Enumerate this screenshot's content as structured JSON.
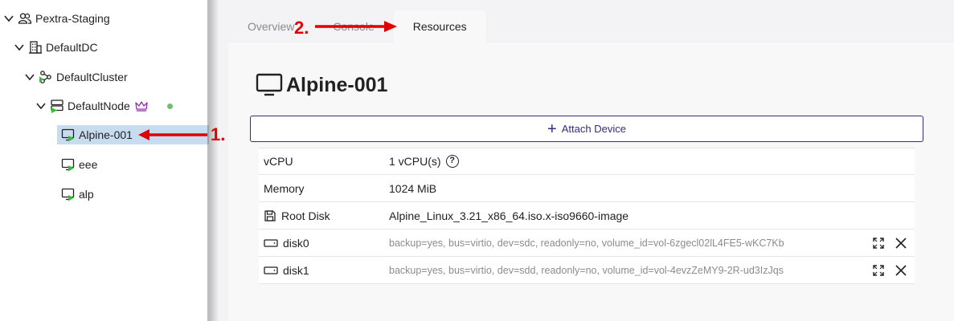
{
  "tree": {
    "items": [
      {
        "label": "Pextra-Staging",
        "icon": "users-icon",
        "expanded": true
      },
      {
        "label": "DefaultDC",
        "icon": "building-icon",
        "expanded": true
      },
      {
        "label": "DefaultCluster",
        "icon": "cluster-icon",
        "expanded": true
      },
      {
        "label": "DefaultNode",
        "icon": "server-icon",
        "expanded": true,
        "badge_icon": "crown-icon",
        "status_color": "#6cc06c"
      },
      {
        "label": "Alpine-001",
        "icon": "monitor-running-icon",
        "selected": true
      },
      {
        "label": "eee",
        "icon": "monitor-running-icon"
      },
      {
        "label": "alp",
        "icon": "monitor-running-icon"
      }
    ]
  },
  "tabs": [
    {
      "label": "Overview",
      "active": false
    },
    {
      "label": "Console",
      "active": false
    },
    {
      "label": "Resources",
      "active": true
    }
  ],
  "vm": {
    "name": "Alpine-001",
    "icon": "monitor-icon"
  },
  "attach_button": {
    "label": "Attach Device",
    "icon": "plus-icon"
  },
  "resources": [
    {
      "key": "vCPU",
      "value": "1 vCPU(s)",
      "help_icon": "?"
    },
    {
      "key": "Memory",
      "value": "1024 MiB"
    },
    {
      "key": "Root Disk",
      "icon": "floppy-icon",
      "value": "Alpine_Linux_3.21_x86_64.iso.x-iso9660-image"
    },
    {
      "key": "disk0",
      "icon": "disk-icon",
      "value": "backup=yes, bus=virtio, dev=sdc, readonly=no, volume_id=vol-6zgecl02lL4FE5-wKC7Kb"
    },
    {
      "key": "disk1",
      "icon": "disk-icon",
      "value": "backup=yes, bus=virtio, dev=sdd, readonly=no, volume_id=vol-4evzZeMY9-2R-ud3IzJqs"
    }
  ],
  "annotations": {
    "step1": "1.",
    "step2": "2.",
    "color": "#e00000"
  },
  "colors": {
    "accent": "#3a2a7a",
    "selected_bg": "#c8dcf0",
    "running_green": "#2ec22e"
  }
}
